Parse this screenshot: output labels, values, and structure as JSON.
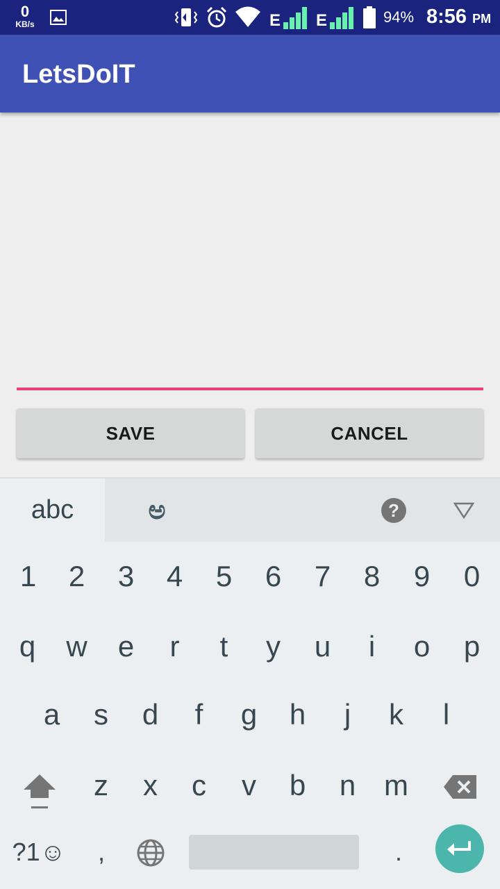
{
  "status_bar": {
    "speed_value": "0",
    "speed_unit": "KB/s",
    "network_1": "E",
    "network_2": "E",
    "battery_percent": "94%",
    "time": "8:56",
    "ampm": "PM",
    "icons": [
      "gallery-icon",
      "vibrate-icon",
      "alarm-icon",
      "wifi-icon",
      "signal-icon",
      "battery-icon"
    ]
  },
  "app_bar": {
    "title": "LetsDoIT",
    "color": "#3f51b5"
  },
  "input": {
    "value": "",
    "underline_color": "#ec407a"
  },
  "buttons": {
    "save": "SAVE",
    "cancel": "CANCEL"
  },
  "keyboard": {
    "lang_primary": "abc",
    "lang_secondary": "ಅ",
    "numbers": [
      "1",
      "2",
      "3",
      "4",
      "5",
      "6",
      "7",
      "8",
      "9",
      "0"
    ],
    "row1": [
      "q",
      "w",
      "e",
      "r",
      "t",
      "y",
      "u",
      "i",
      "o",
      "p"
    ],
    "row2": [
      "a",
      "s",
      "d",
      "f",
      "g",
      "h",
      "j",
      "k",
      "l"
    ],
    "row3": [
      "z",
      "x",
      "c",
      "v",
      "b",
      "n",
      "m"
    ],
    "symbols_label": "?1☺",
    "comma": ",",
    "period": ".",
    "help": "?",
    "enter_color": "#4db6ac"
  }
}
